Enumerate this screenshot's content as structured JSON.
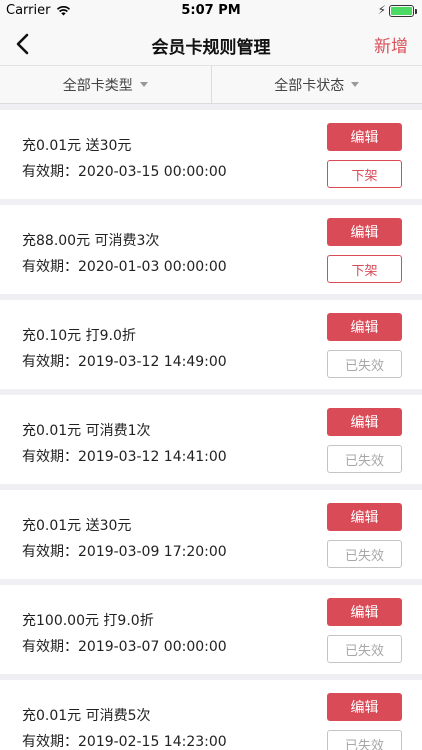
{
  "status_bar": {
    "carrier": "Carrier",
    "time": "5:07 PM"
  },
  "nav": {
    "title": "会员卡规则管理",
    "add_label": "新增"
  },
  "filters": [
    {
      "label": "全部卡类型"
    },
    {
      "label": "全部卡状态"
    }
  ],
  "cards": [
    {
      "rule": "充0.01元 送30元",
      "validity": "有效期：2020-03-15 00:00:00",
      "edit_label": "编辑",
      "status_label": "下架",
      "status": "active"
    },
    {
      "rule": "充88.00元 可消费3次",
      "validity": "有效期：2020-01-03 00:00:00",
      "edit_label": "编辑",
      "status_label": "下架",
      "status": "active"
    },
    {
      "rule": "充0.10元 打9.0折",
      "validity": "有效期：2019-03-12 14:49:00",
      "edit_label": "编辑",
      "status_label": "已失效",
      "status": "expired"
    },
    {
      "rule": "充0.01元 可消费1次",
      "validity": "有效期：2019-03-12 14:41:00",
      "edit_label": "编辑",
      "status_label": "已失效",
      "status": "expired"
    },
    {
      "rule": "充0.01元 送30元",
      "validity": "有效期：2019-03-09 17:20:00",
      "edit_label": "编辑",
      "status_label": "已失效",
      "status": "expired"
    },
    {
      "rule": "充100.00元 打9.0折",
      "validity": "有效期：2019-03-07 00:00:00",
      "edit_label": "编辑",
      "status_label": "已失效",
      "status": "expired"
    },
    {
      "rule": "充0.01元 可消费5次",
      "validity": "有效期：2019-02-15 14:23:00",
      "edit_label": "编辑",
      "status_label": "已失效",
      "status": "expired"
    }
  ],
  "colors": {
    "accent": "#d94b57",
    "disabled": "#a8a8a8",
    "background": "#efeff4"
  }
}
